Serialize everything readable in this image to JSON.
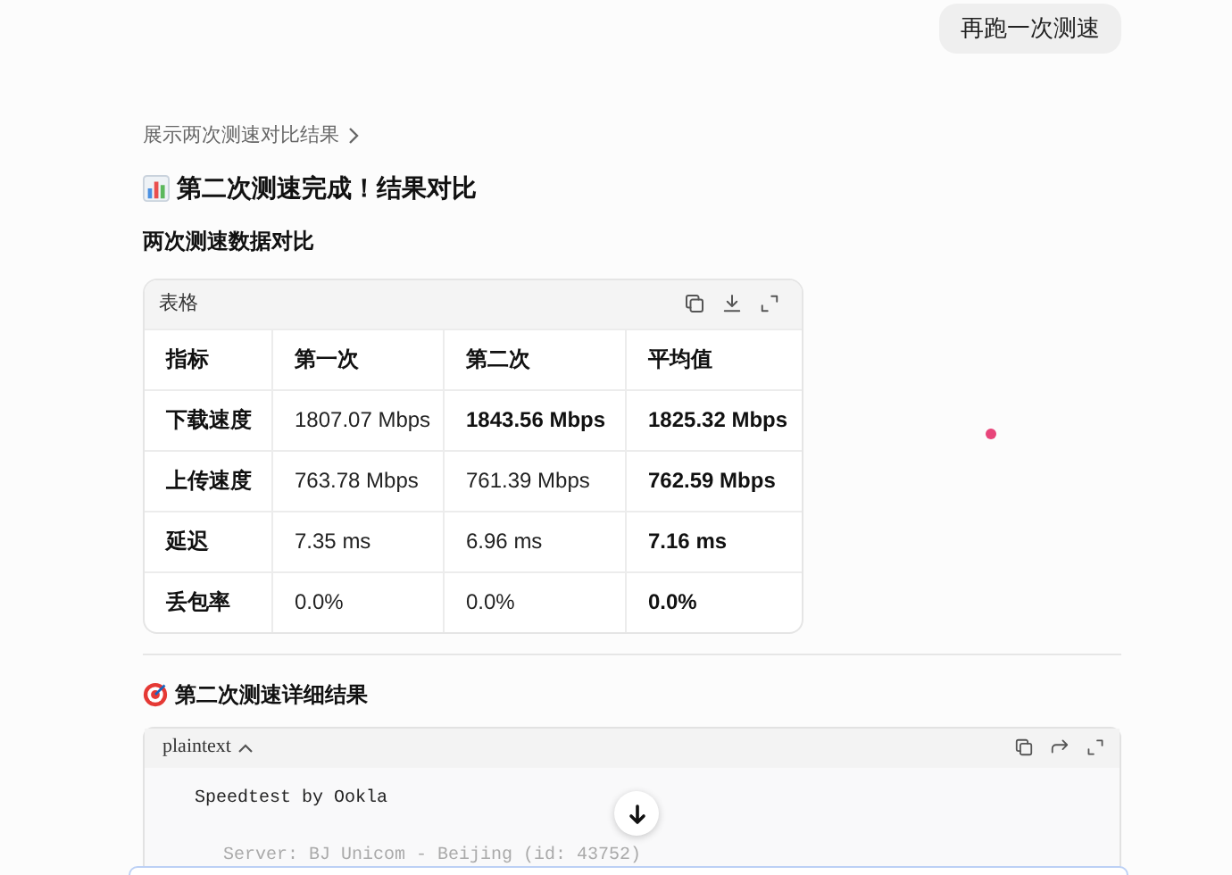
{
  "user_message": "再跑一次测速",
  "toggle_link": "展示两次测速对比结果",
  "heading": "第二次测速完成！结果对比",
  "subheading": "两次测速数据对比",
  "table": {
    "label": "表格",
    "columns": [
      "指标",
      "第一次",
      "第二次",
      "平均值"
    ],
    "rows": [
      [
        {
          "text": "下载速度",
          "bold": true
        },
        {
          "text": "1807.07 Mbps",
          "bold": false
        },
        {
          "text": "1843.56 Mbps",
          "bold": true
        },
        {
          "text": "1825.32 Mbps",
          "bold": true
        }
      ],
      [
        {
          "text": "上传速度",
          "bold": true
        },
        {
          "text": "763.78 Mbps",
          "bold": false
        },
        {
          "text": "761.39 Mbps",
          "bold": false
        },
        {
          "text": "762.59 Mbps",
          "bold": true
        }
      ],
      [
        {
          "text": "延迟",
          "bold": true
        },
        {
          "text": "7.35 ms",
          "bold": false
        },
        {
          "text": "6.96 ms",
          "bold": false
        },
        {
          "text": "7.16 ms",
          "bold": true
        }
      ],
      [
        {
          "text": "丢包率",
          "bold": true
        },
        {
          "text": "0.0%",
          "bold": false
        },
        {
          "text": "0.0%",
          "bold": false
        },
        {
          "text": "0.0%",
          "bold": true
        }
      ]
    ]
  },
  "detail_heading": "第二次测速详细结果",
  "code_block": {
    "language": "plaintext",
    "expanded": true,
    "lines": [
      {
        "text": "Speedtest by Ookla",
        "dim": false
      },
      {
        "text": "Server: BJ Unicom - Beijing (id: 43752)",
        "dim": true
      }
    ]
  }
}
